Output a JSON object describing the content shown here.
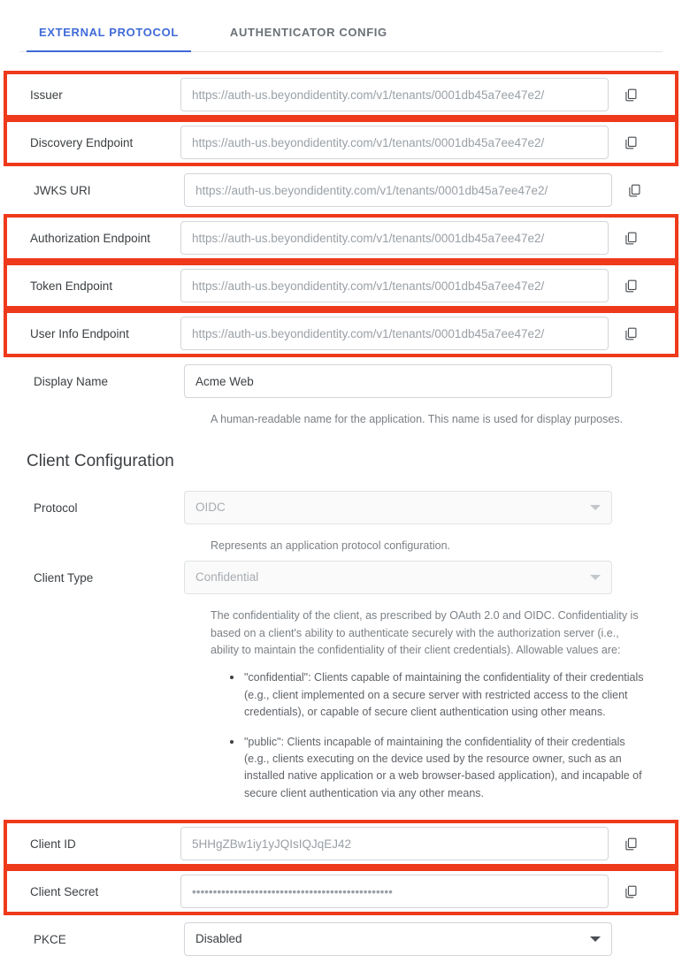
{
  "tabs": [
    {
      "label": "EXTERNAL PROTOCOL",
      "active": true
    },
    {
      "label": "AUTHENTICATOR CONFIG",
      "active": false
    }
  ],
  "colors": {
    "accent_blue": "#3f6ad8",
    "highlight_red": "#ee3a1b",
    "label_text": "#3c4043",
    "placeholder_text": "#9aa0a6"
  },
  "icons": {
    "copy": "copy-icon",
    "chevron": "chevron-down-icon"
  },
  "fields": {
    "issuer": {
      "label": "Issuer",
      "value": "https://auth-us.beyondidentity.com/v1/tenants/0001db45a7ee47e2/",
      "highlighted": true
    },
    "discovery_endpoint": {
      "label": "Discovery Endpoint",
      "value": "https://auth-us.beyondidentity.com/v1/tenants/0001db45a7ee47e2/",
      "highlighted": true
    },
    "jwks_uri": {
      "label": "JWKS URI",
      "value": "https://auth-us.beyondidentity.com/v1/tenants/0001db45a7ee47e2/",
      "highlighted": false
    },
    "authorization_endpoint": {
      "label": "Authorization Endpoint",
      "value": "https://auth-us.beyondidentity.com/v1/tenants/0001db45a7ee47e2/",
      "highlighted": true
    },
    "token_endpoint": {
      "label": "Token Endpoint",
      "value": "https://auth-us.beyondidentity.com/v1/tenants/0001db45a7ee47e2/",
      "highlighted": true
    },
    "user_info_endpoint": {
      "label": "User Info Endpoint",
      "value": "https://auth-us.beyondidentity.com/v1/tenants/0001db45a7ee47e2/",
      "highlighted": true
    },
    "display_name": {
      "label": "Display Name",
      "value": "Acme Web",
      "helper": "A human-readable name for the application. This name is used for display purposes."
    },
    "protocol": {
      "label": "Protocol",
      "value": "OIDC",
      "helper": "Represents an application protocol configuration.",
      "disabled": true
    },
    "client_type": {
      "label": "Client Type",
      "value": "Confidential",
      "disabled": true,
      "helper_paragraph": "The confidentiality of the client, as prescribed by OAuth 2.0 and OIDC. Confidentiality is based on a client's ability to authenticate securely with the authorization server (i.e., ability to maintain the confidentiality of their client credentials). Allowable values are:",
      "helper_bullets": [
        "\"confidential\": Clients capable of maintaining the confidentiality of their credentials (e.g., client implemented on a secure server with restricted access to the client credentials), or capable of secure client authentication using other means.",
        "\"public\": Clients incapable of maintaining the confidentiality of their credentials (e.g., clients executing on the device used by the resource owner, such as an installed native application or a web browser-based application), and incapable of secure client authentication via any other means."
      ]
    },
    "client_id": {
      "label": "Client ID",
      "value": "5HHgZBw1iy1yJQIsIQJqEJ42",
      "highlighted": true
    },
    "client_secret": {
      "label": "Client Secret",
      "value": "••••••••••••••••••••••••••••••••••••••••••••••••",
      "highlighted": true
    },
    "pkce": {
      "label": "PKCE",
      "value": "Disabled"
    }
  },
  "section": {
    "client_configuration_title": "Client Configuration"
  }
}
